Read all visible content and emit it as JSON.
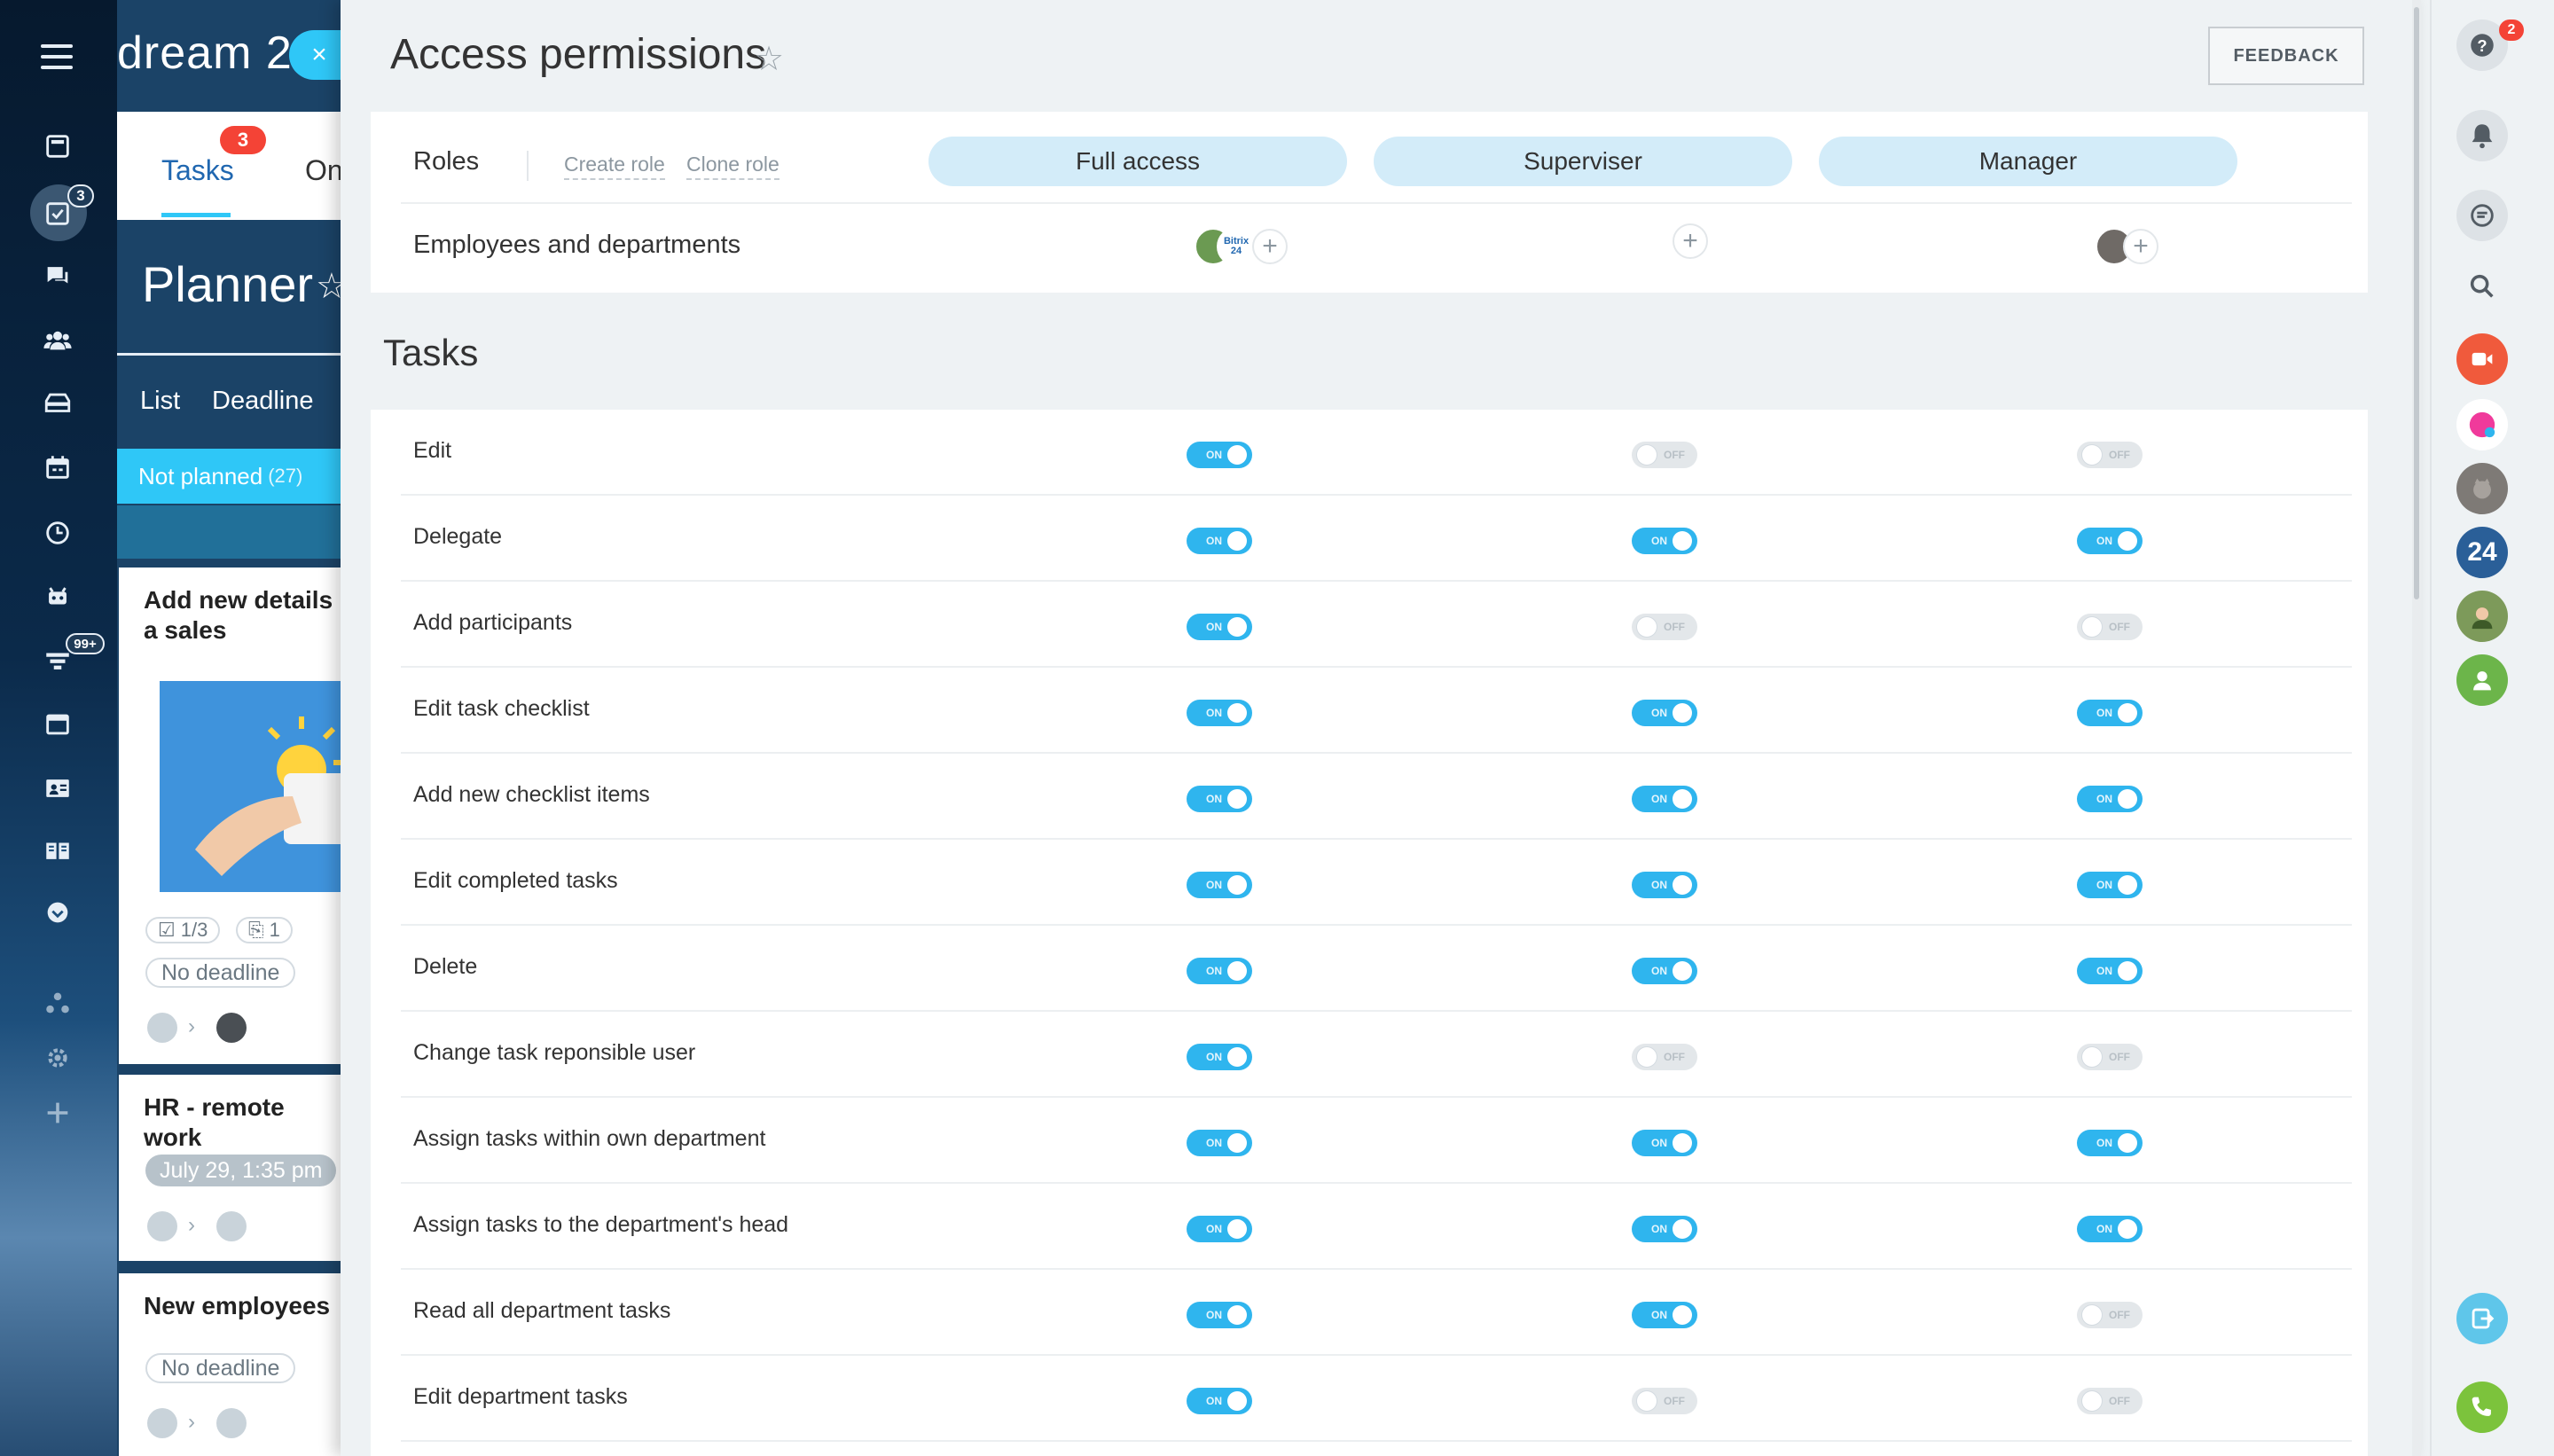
{
  "app": {
    "brand": "dream 2",
    "close_glyph": "×"
  },
  "leftbar": {
    "badges": {
      "tasks": "3",
      "filter": "99+"
    },
    "icons": [
      "menu-icon",
      "news-feed-icon",
      "tasks-icon",
      "chat-icon",
      "employees-icon",
      "drive-icon",
      "calendar-icon",
      "time-icon",
      "robot-icon",
      "filter-icon",
      "sites-icon",
      "contacts-icon",
      "knowledge-base-icon",
      "more-icon",
      "network-icon",
      "settings-icon",
      "add-icon"
    ]
  },
  "background_panel": {
    "tab_tasks": "Tasks",
    "tab_tasks_badge": "3",
    "tab_next": "On",
    "planner_title": "Planner",
    "view_list": "List",
    "view_deadline": "Deadline",
    "column_title": "Not planned",
    "column_count": "(27)",
    "cards": [
      {
        "title": "Add new details a sales",
        "checklist": "1/3",
        "attachments": "1",
        "deadline": "No deadline"
      },
      {
        "title": "HR - remote work",
        "date": "July 29, 1:35 pm"
      },
      {
        "title": "New employees",
        "deadline": "No deadline"
      }
    ]
  },
  "main": {
    "title": "Access permissions",
    "feedback_label": "FEEDBACK",
    "roles_label": "Roles",
    "create_role": "Create role",
    "clone_role": "Clone role",
    "roles": [
      "Full access",
      "Superviser",
      "Manager"
    ],
    "employees_label": "Employees and departments",
    "avatar_badge_text": "Bitrix 24",
    "tasks_section": "Tasks",
    "toggle_on": "ON",
    "toggle_off": "OFF",
    "permissions": [
      {
        "label": "Edit",
        "values": [
          true,
          false,
          false
        ]
      },
      {
        "label": "Delegate",
        "values": [
          true,
          true,
          true
        ]
      },
      {
        "label": "Add participants",
        "values": [
          true,
          false,
          false
        ]
      },
      {
        "label": "Edit task checklist",
        "values": [
          true,
          true,
          true
        ]
      },
      {
        "label": "Add new checklist items",
        "values": [
          true,
          true,
          true
        ]
      },
      {
        "label": "Edit completed tasks",
        "values": [
          true,
          true,
          true
        ]
      },
      {
        "label": "Delete",
        "values": [
          true,
          true,
          true
        ]
      },
      {
        "label": "Change task reponsible user",
        "values": [
          true,
          false,
          false
        ]
      },
      {
        "label": "Assign tasks within own department",
        "values": [
          true,
          true,
          true
        ]
      },
      {
        "label": "Assign tasks to the department's head",
        "values": [
          true,
          true,
          true
        ]
      },
      {
        "label": "Read all department tasks",
        "values": [
          true,
          true,
          false
        ]
      },
      {
        "label": "Edit department tasks",
        "values": [
          true,
          false,
          false
        ]
      }
    ]
  },
  "rightbar": {
    "help_badge": "2",
    "avatar_24": "24",
    "icons": [
      "help-icon",
      "notifications-icon",
      "chat-list-icon",
      "search-icon",
      "video-call-icon",
      "user-avatar",
      "cat-avatar",
      "bitrix24-avatar",
      "user-avatar",
      "user-icon",
      "screen-share-icon",
      "phone-icon"
    ]
  },
  "colors": {
    "accent": "#2fc7f7",
    "toggle_on": "#2fb5ee",
    "toggle_off": "#e3e7ea",
    "role_pill": "#d3ecf9",
    "badge_red": "#f44336"
  }
}
